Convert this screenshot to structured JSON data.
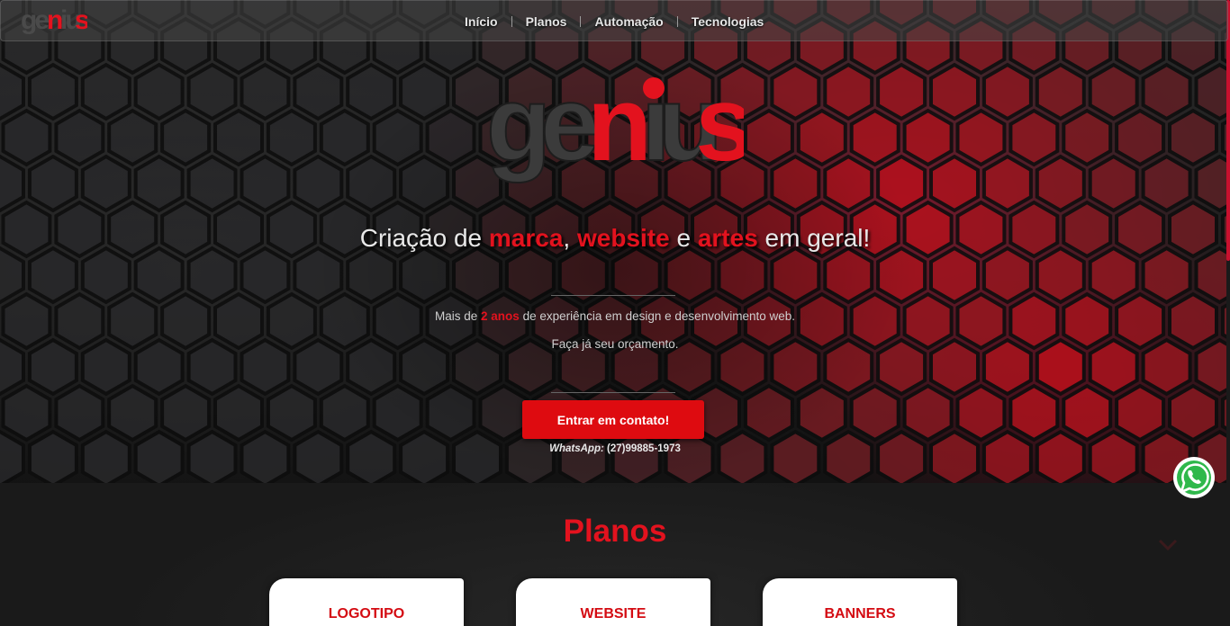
{
  "brand": {
    "logo_text": "genius",
    "accent": "#e3121e"
  },
  "nav": {
    "links": [
      "Início",
      "Planos",
      "Automação",
      "Tecnologias"
    ]
  },
  "hero": {
    "headline": {
      "p1": "Criação de ",
      "h1": "marca",
      "p2": ", ",
      "h2": "website",
      "p3": " e ",
      "h3": "artes",
      "p4": " em geral!"
    },
    "experience": {
      "pre": "Mais de ",
      "highlight": "2 anos",
      "post": " de experiência em design e desenvolvimento web."
    },
    "cta_text": "Faça já seu orçamento.",
    "button_label": "Entrar em contato!",
    "whatsapp_label": "WhatsApp:",
    "whatsapp_number": "(27)99885-1973"
  },
  "plans": {
    "title": "Planos",
    "cards": [
      {
        "title": "LOGOTIPO"
      },
      {
        "title": "WEBSITE"
      },
      {
        "title": "BANNERS"
      }
    ]
  },
  "floating": {
    "whatsapp_icon": "whatsapp-icon"
  }
}
